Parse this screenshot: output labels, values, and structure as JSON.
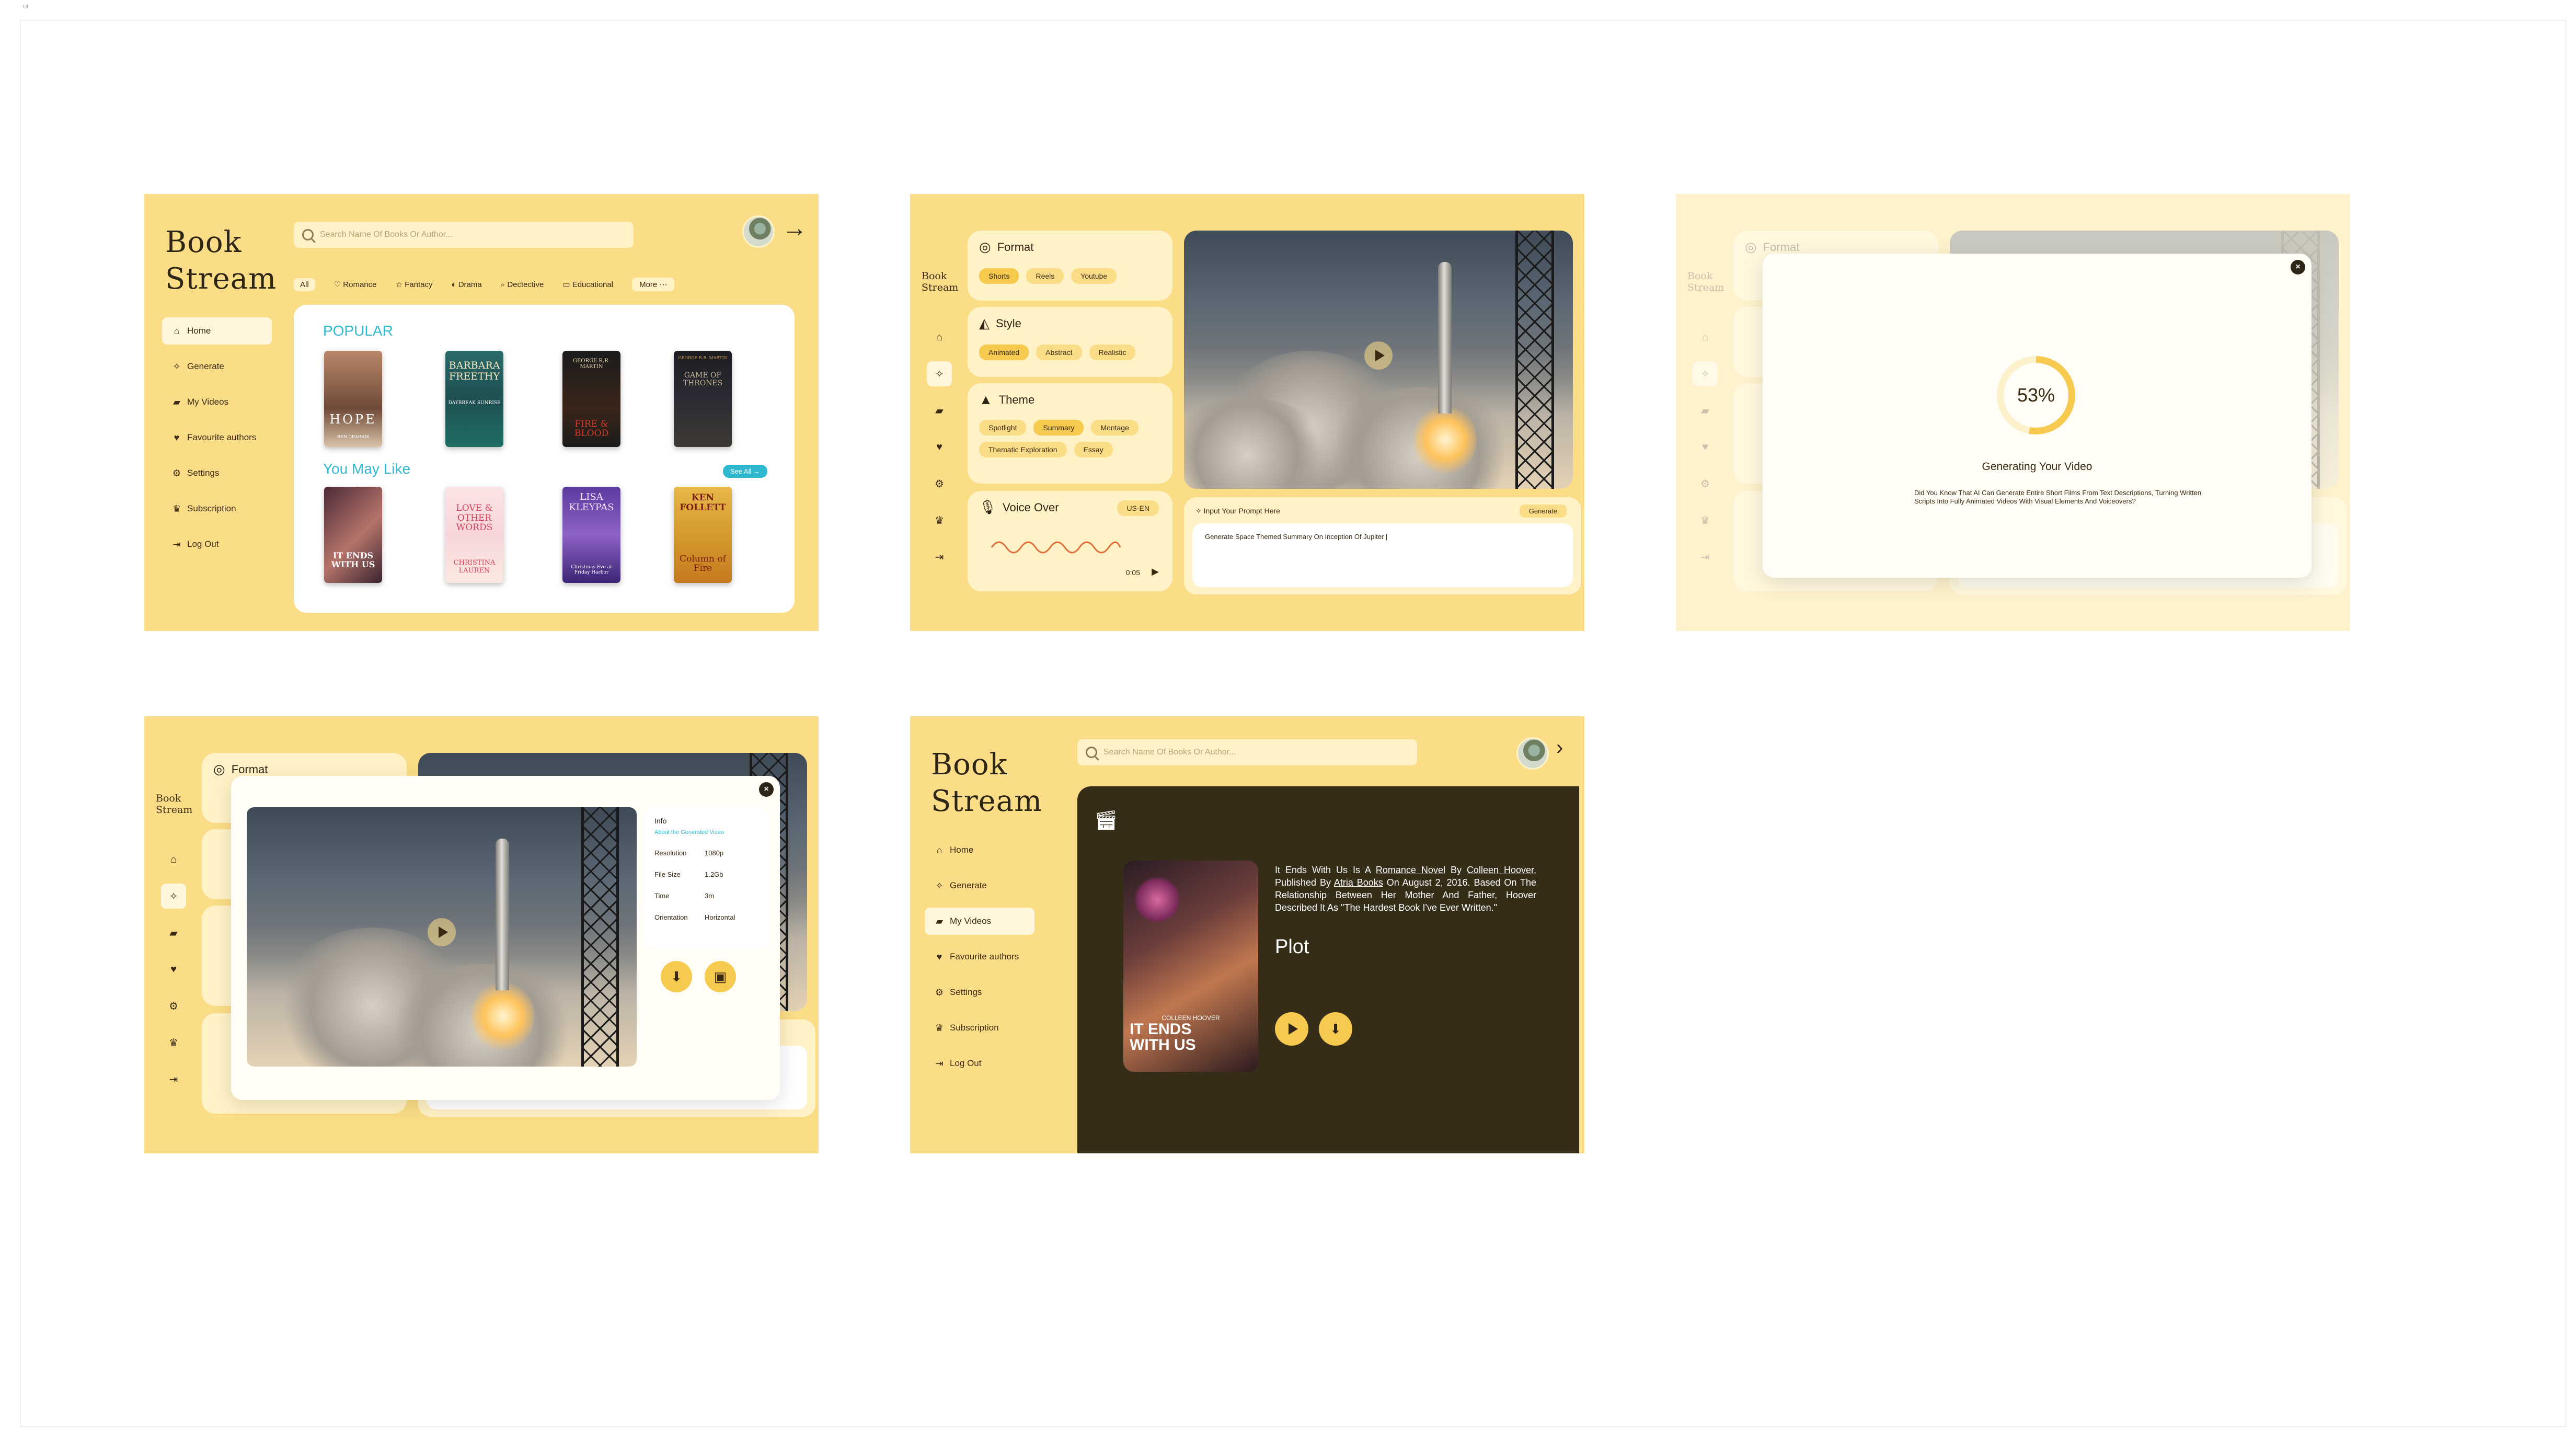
{
  "corner_label": "UI",
  "brand": {
    "line1": "Book",
    "line2": "Stream"
  },
  "search": {
    "placeholder": "Search Name Of Books Or Author..."
  },
  "sidebar": {
    "items": [
      {
        "label": "Home",
        "icon": "home-icon"
      },
      {
        "label": "Generate",
        "icon": "sparkle-icon"
      },
      {
        "label": "My Videos",
        "icon": "video-icon"
      },
      {
        "label": "Favourite authors",
        "icon": "heart-icon"
      },
      {
        "label": "Settings",
        "icon": "gear-icon"
      },
      {
        "label": "Subscription",
        "icon": "crown-icon"
      },
      {
        "label": "Log Out",
        "icon": "logout-icon"
      }
    ]
  },
  "genres": [
    "All",
    "Romance",
    "Fantacy",
    "Drama",
    "Dectective",
    "Educational",
    "More"
  ],
  "home": {
    "popular_title": "POPULAR",
    "you_may_like_title": "You May Like",
    "see_all": "See All",
    "popular": [
      {
        "title": "HOPE",
        "author": "BEN GRAHAM"
      },
      {
        "title": "BARBARA FREETHY",
        "author": "DAYBREAK SUNRISE"
      },
      {
        "title": "FIRE & BLOOD",
        "author": "GEORGE R.R. MARTIN"
      },
      {
        "title": "GAME OF THRONES",
        "author": "GEORGE R.R. MARTIN"
      }
    ],
    "you_may_like": [
      {
        "title": "IT ENDS WITH US",
        "author": "COLLEEN HOOVER"
      },
      {
        "title": "LOVE & OTHER WORDS",
        "author": "CHRISTINA LAUREN"
      },
      {
        "title": "LISA KLEYPAS",
        "author": "Christmas Eve at Friday Harbor"
      },
      {
        "title": "Column of Fire",
        "author": "KEN FOLLETT"
      }
    ]
  },
  "generate": {
    "format": {
      "title": "Format",
      "options": [
        "Shorts",
        "Reels",
        "Youtube"
      ]
    },
    "style": {
      "title": "Style",
      "options": [
        "Animated",
        "Abstract",
        "Realistic"
      ]
    },
    "theme": {
      "title": "Theme",
      "options": [
        "Spotlight",
        "Summary",
        "Montage",
        "Thematic Exploration",
        "Essay"
      ]
    },
    "voice": {
      "title": "Voice Over",
      "locale": "US-EN",
      "time": "0:05"
    },
    "prompt": {
      "label": "Input Your Prompt Here",
      "button": "Generate",
      "value": "Generate Space Themed Summary On Inception Of Jupiter |"
    }
  },
  "progress": {
    "percent": "53%",
    "fraction": 0.53,
    "title": "Generating Your Video",
    "tip": "Did You Know That AI Can Generate Entire Short Films From Text Descriptions, Turning Written Scripts Into Fully Animated Videos With Visual Elements And Voiceovers?"
  },
  "info": {
    "title": "Info",
    "subtitle": "About the Generated Video",
    "rows": [
      {
        "label": "Resolution",
        "value": "1080p"
      },
      {
        "label": "File Size",
        "value": "1.2Gb"
      },
      {
        "label": "Time",
        "value": "3m"
      },
      {
        "label": "Orientation",
        "value": "Horizontal"
      }
    ]
  },
  "my_videos": {
    "summary_parts": {
      "a": "It Ends With Us Is A ",
      "b": "Romance Novel",
      "c": " By ",
      "d": "Colleen Hoover",
      "e": ", Published By ",
      "f": "Atria Books",
      "g": " On August 2, 2016. Based On The Relationship Between Her Mother And Father, Hoover Described It As \"The Hardest Book I've Ever Written.\""
    },
    "plot_label": "Plot",
    "cover_title": "IT ENDS WITH US",
    "cover_author": "COLLEEN HOOVER"
  },
  "colors": {
    "bg": "#fbdd87",
    "panel": "#fff2c6",
    "accent": "#2fb9d1",
    "dark": "#362d19",
    "button": "#f6c94f"
  }
}
